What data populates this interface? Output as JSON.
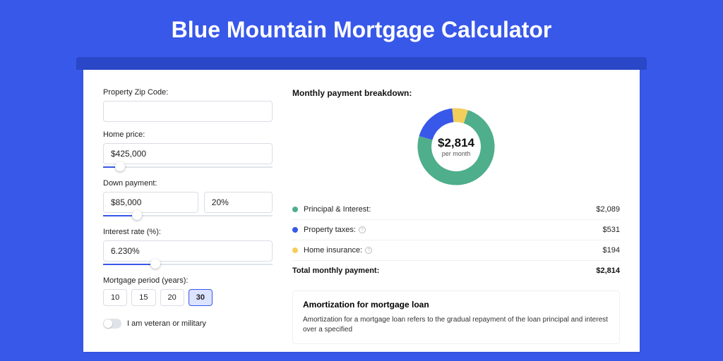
{
  "title": "Blue Mountain Mortgage Calculator",
  "form": {
    "zip_label": "Property Zip Code:",
    "zip_value": "",
    "price_label": "Home price:",
    "price_value": "$425,000",
    "price_slider_pct": 10,
    "down_label": "Down payment:",
    "down_value": "$85,000",
    "down_pct_value": "20%",
    "down_slider_pct": 20,
    "rate_label": "Interest rate (%):",
    "rate_value": "6.230%",
    "rate_slider_pct": 31,
    "term_label": "Mortgage period (years):",
    "term_options": [
      "10",
      "15",
      "20",
      "30"
    ],
    "term_selected_index": 3,
    "vet_label": "I am veteran or military"
  },
  "breakdown": {
    "title": "Monthly payment breakdown:",
    "center_value": "$2,814",
    "center_sub": "per month",
    "items": [
      {
        "label": "Principal & Interest:",
        "amount": "$2,089",
        "color": "#4fae8b",
        "help": false,
        "pct": 74.3
      },
      {
        "label": "Property taxes:",
        "amount": "$531",
        "color": "#3858e9",
        "help": true,
        "pct": 18.9
      },
      {
        "label": "Home insurance:",
        "amount": "$194",
        "color": "#f2cf5b",
        "help": true,
        "pct": 6.8
      }
    ],
    "total_label": "Total monthly payment:",
    "total_value": "$2,814"
  },
  "chart_data": {
    "type": "pie",
    "title": "Monthly payment breakdown",
    "categories": [
      "Principal & Interest",
      "Property taxes",
      "Home insurance"
    ],
    "values": [
      2089,
      531,
      194
    ],
    "colors": [
      "#4fae8b",
      "#3858e9",
      "#f2cf5b"
    ],
    "center_label": "$2,814 per month",
    "donut": true
  },
  "amort": {
    "title": "Amortization for mortgage loan",
    "text": "Amortization for a mortgage loan refers to the gradual repayment of the loan principal and interest over a specified"
  }
}
